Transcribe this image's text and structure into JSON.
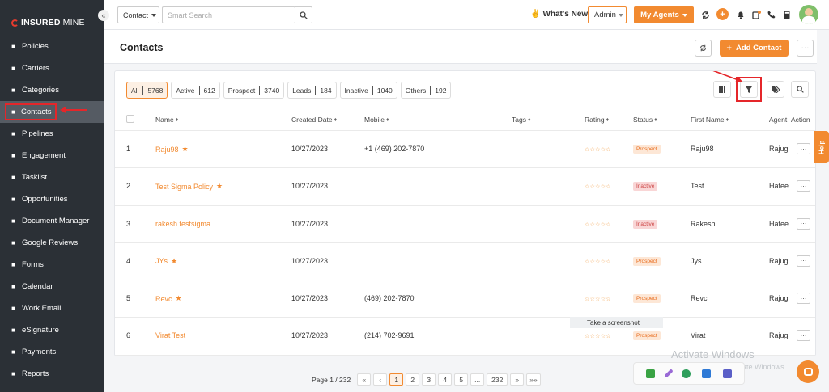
{
  "brand": {
    "name_bold": "INSURED",
    "name_light": "MINE"
  },
  "sidebar": {
    "collapse_glyph": "«",
    "items": [
      {
        "label": "Policies"
      },
      {
        "label": "Carriers"
      },
      {
        "label": "Categories"
      },
      {
        "label": "Contacts"
      },
      {
        "label": "Pipelines"
      },
      {
        "label": "Engagement"
      },
      {
        "label": "Tasklist"
      },
      {
        "label": "Opportunities"
      },
      {
        "label": "Document Manager"
      },
      {
        "label": "Google Reviews"
      },
      {
        "label": "Forms"
      },
      {
        "label": "Calendar"
      },
      {
        "label": "Work Email"
      },
      {
        "label": "eSignature"
      },
      {
        "label": "Payments"
      },
      {
        "label": "Reports"
      }
    ],
    "active_index": 3
  },
  "topbar": {
    "search_type": "Contact",
    "search_placeholder": "Smart Search",
    "whats_new": "What's New",
    "role": "Admin",
    "my_agents": "My Agents"
  },
  "header": {
    "title": "Contacts",
    "add_contact": "Add Contact"
  },
  "filters": [
    {
      "label": "All",
      "count": "5768",
      "active": true
    },
    {
      "label": "Active",
      "count": "612"
    },
    {
      "label": "Prospect",
      "count": "3740"
    },
    {
      "label": "Leads",
      "count": "184"
    },
    {
      "label": "Inactive",
      "count": "1040"
    },
    {
      "label": "Others",
      "count": "192"
    }
  ],
  "table": {
    "columns": {
      "name": "Name",
      "created": "Created Date",
      "mobile": "Mobile",
      "tags": "Tags",
      "rating": "Rating",
      "status": "Status",
      "first_name": "First Name",
      "agent": "Agent",
      "action": "Action"
    },
    "rows": [
      {
        "num": "1",
        "name": "Raju98",
        "starred": true,
        "created": "10/27/2023",
        "mobile": "+1 (469) 202-7870",
        "rating": "☆☆☆☆☆",
        "status": "Prospect",
        "first_name": "Raju98",
        "agent": "Rajug"
      },
      {
        "num": "2",
        "name": "Test Sigma Policy",
        "starred": true,
        "created": "10/27/2023",
        "mobile": "",
        "rating": "☆☆☆☆☆",
        "status": "Inactive",
        "first_name": "Test",
        "agent": "Hafee"
      },
      {
        "num": "3",
        "name": "rakesh testsigma",
        "starred": false,
        "created": "10/27/2023",
        "mobile": "",
        "rating": "☆☆☆☆☆",
        "status": "Inactive",
        "first_name": "Rakesh",
        "agent": "Hafee"
      },
      {
        "num": "4",
        "name": "JYs",
        "starred": true,
        "created": "10/27/2023",
        "mobile": "",
        "rating": "☆☆☆☆☆",
        "status": "Prospect",
        "first_name": "Jys",
        "agent": "Rajug"
      },
      {
        "num": "5",
        "name": "Revc",
        "starred": true,
        "created": "10/27/2023",
        "mobile": "(469) 202-7870",
        "rating": "☆☆☆☆☆",
        "status": "Prospect",
        "first_name": "Revc",
        "agent": "Rajug"
      },
      {
        "num": "6",
        "name": "Virat Test",
        "starred": false,
        "created": "10/27/2023",
        "mobile": "(214) 702-9691",
        "rating": "☆☆☆☆☆",
        "status": "Prospect",
        "first_name": "Virat",
        "agent": "Rajug"
      }
    ],
    "action_glyph": "···"
  },
  "pagination": {
    "label": "Page 1 / 232",
    "first": "«",
    "prev": "‹",
    "pages": [
      "1",
      "2",
      "3",
      "4",
      "5",
      "...",
      "232"
    ],
    "next": "»",
    "last": "»»",
    "current": "1"
  },
  "help_tab": "Help",
  "tooltip": "Take a screenshot",
  "windows": {
    "activate": "Activate Windows",
    "hint": "Go to Settings to activate Windows."
  },
  "colors": {
    "accent": "#f28a30",
    "sidebar_bg": "#2b3036",
    "highlight_red": "#e5262a"
  }
}
